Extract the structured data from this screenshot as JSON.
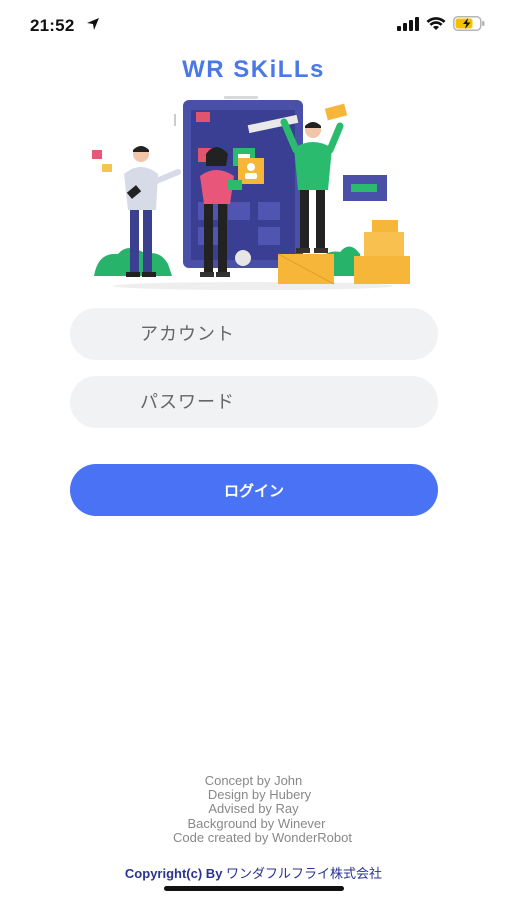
{
  "status_bar": {
    "time": "21:52",
    "icons": [
      "location-arrow-icon",
      "cellular-signal-icon",
      "wifi-icon",
      "battery-charging-icon"
    ],
    "battery_color": "#f5c000"
  },
  "app": {
    "title": "WR SKiLLs",
    "title_color": "#4a78e6",
    "hero_image": "team-building-app-illustration"
  },
  "form": {
    "account_placeholder": "アカウント",
    "password_placeholder": "パスワード",
    "login_label": "ログイン",
    "login_color": "#4a72f5"
  },
  "credits": [
    "Concept by John",
    "Design by Hubery",
    "Advised by Ray",
    "Background by Winever",
    "Code created by WonderRobot"
  ],
  "footer": {
    "copyright_prefix": "Copyright(c) By",
    "company": "ワンダフルフライ株式会社"
  }
}
